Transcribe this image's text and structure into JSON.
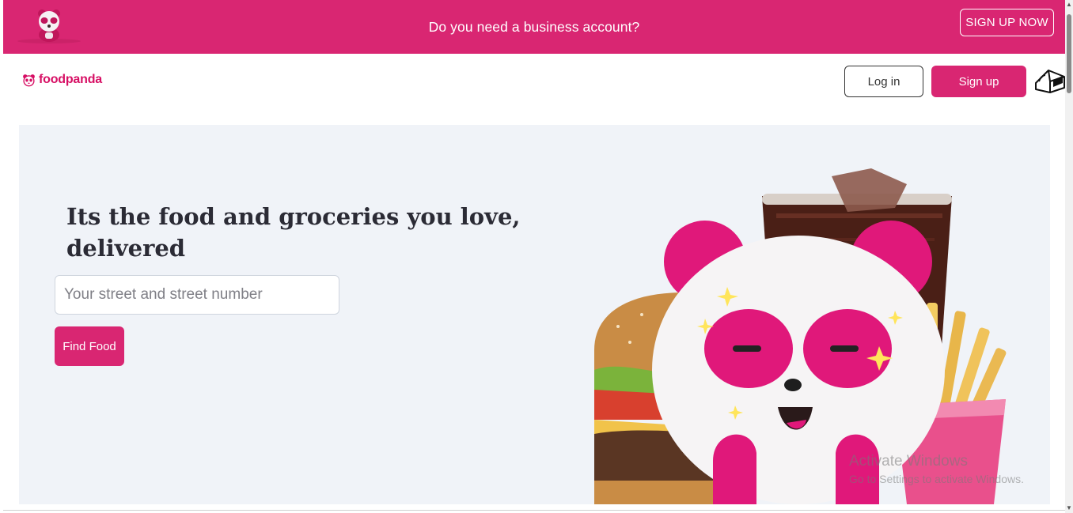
{
  "banner": {
    "text": "Do you need a business account?",
    "cta": "SIGN UP NOW"
  },
  "header": {
    "logo_text": "foodpanda",
    "login_label": "Log in",
    "signup_label": "Sign up"
  },
  "hero": {
    "headline": "Its the food and groceries you love, delivered",
    "address_placeholder": "Your street and street number",
    "address_value": "",
    "find_label": "Find Food"
  },
  "watermark": {
    "title": "Activate Windows",
    "subtitle": "Go to Settings to activate Windows."
  },
  "colors": {
    "brand": "#d92672",
    "logo": "#d70f64",
    "hero_bg": "#f0f3f8"
  },
  "icons": [
    "panda-mascot-icon",
    "panda-logo-icon",
    "shopping-bag-icon"
  ]
}
